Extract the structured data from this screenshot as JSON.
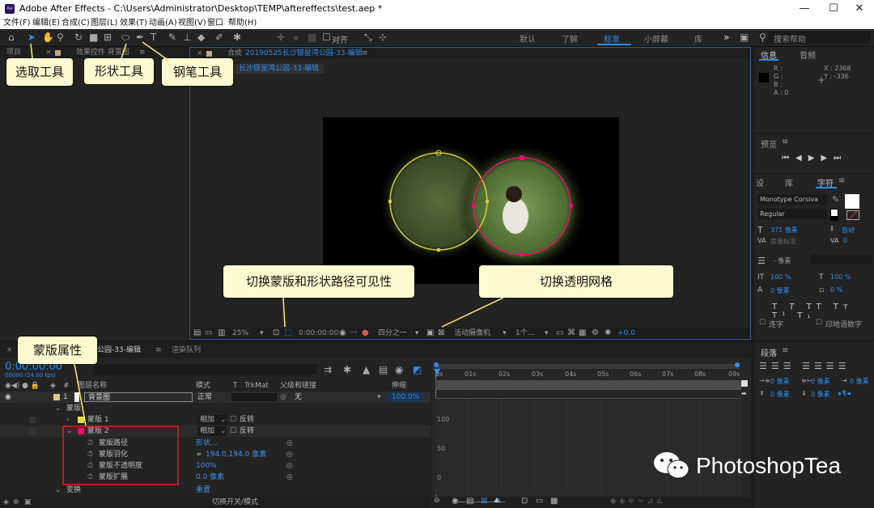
{
  "titlebar": {
    "title": "Adobe After Effects - C:\\Users\\Administrator\\Desktop\\TEMP\\aftereffects\\test.aep *",
    "logo": "Ae"
  },
  "menu": [
    "文件(F)",
    "编辑(E)",
    "合成(C)",
    "图层(L)",
    "效果(T)",
    "动画(A)",
    "视图(V)",
    "窗口",
    "帮助(H)"
  ],
  "toolbar": {
    "align_label": "对齐",
    "workspaces": [
      "默认",
      "了解",
      "标准",
      "小屏幕",
      "库"
    ],
    "active_workspace": "标准",
    "search_placeholder": "搜索帮助"
  },
  "project_panel": {
    "tab1": "项目",
    "tab2": "效果控件 背景图"
  },
  "comp_panel": {
    "tab": "合成",
    "comp_name": "20190525长沙银星湾公园-33-编辑",
    "breadcrumb": "长沙银星湾公园-33-编辑",
    "zoom": "25%",
    "timecode": "0:00:00:00",
    "resolution": "四分之一",
    "camera": "活动摄像机",
    "views": "1个...",
    "exposure": "+0.0"
  },
  "callouts": {
    "select_tool": "选取工具",
    "shape_tool": "形状工具",
    "pen_tool": "钢笔工具",
    "toggle_mask": "切换蒙版和形状路径可见性",
    "toggle_grid": "切换透明网格",
    "mask_props": "蒙版属性"
  },
  "info_panel": {
    "tab1": "信息",
    "tab2": "音频",
    "r": "R :",
    "g": "G :",
    "b": "B :",
    "a": "A : 0",
    "x": "X : 2368",
    "y": "Y : -336"
  },
  "preview_panel": {
    "title": "预览"
  },
  "char_panel": {
    "tab1": "设",
    "tab2": "库",
    "tab3": "字符",
    "font": "Monotype Corsiva",
    "style": "Regular",
    "size": "371 像素",
    "leading": "自动",
    "kerning": "度量标准",
    "tracking": "0",
    "stroke": "- 像素",
    "vscale": "100 %",
    "hscale": "100 %",
    "baseline": "0 像素",
    "tsume": "0 %",
    "ligature": "连字",
    "hindi": "印地语数字"
  },
  "para_panel": {
    "title": "段落",
    "v1": "0 像素",
    "v2": "0 像素",
    "v3": "0 像素",
    "v4": "0 像素",
    "v5": "0 像素"
  },
  "timeline": {
    "tab": "公园-33-编辑",
    "render_tab": "渲染队列",
    "timecode": "0:00:00:00",
    "fps": "00000 (24.00 fps)",
    "col_layer": "图层名称",
    "col_mode": "模式",
    "col_t": "T",
    "col_trkmat": "TrkMat",
    "col_parent": "父级和链接",
    "col_stretch": "伸缩",
    "layer": {
      "num": "1",
      "name": "背景图",
      "mode": "正常",
      "parent": "无",
      "stretch": "100.0%"
    },
    "masks_label": "蒙版",
    "mask1": "蒙版 1",
    "mask2": "蒙版 2",
    "mode_add": "相加",
    "invert": "反转",
    "props": [
      {
        "name": "蒙版路径",
        "value": "形状..."
      },
      {
        "name": "蒙版羽化",
        "value": "194.0,194.0 像素"
      },
      {
        "name": "蒙版不透明度",
        "value": "100%"
      },
      {
        "name": "蒙版扩展",
        "value": "0.0 像素"
      }
    ],
    "transform": "变换",
    "transform_reset": "重置",
    "toggle_switch": "切换开关/模式",
    "ruler": [
      "0s",
      "01s",
      "02s",
      "03s",
      "04s",
      "05s",
      "06s",
      "07s",
      "08s",
      "09s"
    ],
    "graph": [
      "100",
      "50",
      "0"
    ]
  },
  "watermark": "PhotoshopTea",
  "colors": {
    "accent": "#2d8ceb",
    "callout": "#fffbd0",
    "mask1": "#e5e03c",
    "mask2": "#e3146a"
  }
}
